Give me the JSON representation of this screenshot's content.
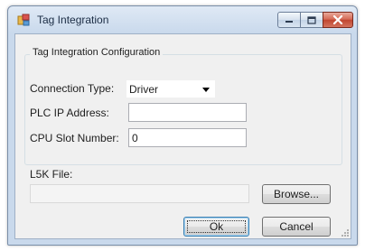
{
  "window": {
    "title": "Tag Integration",
    "app_icon": "tag-app-icon",
    "controls": [
      "minimize-icon",
      "maximize-icon",
      "close-icon"
    ]
  },
  "group": {
    "label": "Tag Integration Configuration"
  },
  "connection_type": {
    "label": "Connection Type:",
    "selected": "Driver"
  },
  "plc_ip": {
    "label": "PLC IP Address:",
    "value": ""
  },
  "cpu_slot": {
    "label": "CPU Slot Number:",
    "value": "0"
  },
  "l5k": {
    "label": "L5K File:",
    "value": "",
    "browse_label": "Browse..."
  },
  "buttons": {
    "ok_label": "Ok",
    "cancel_label": "Cancel"
  },
  "colors": {
    "titlebar": "#c9d9ec",
    "client": "#f0f0f0",
    "close_button": "#c04630",
    "default_button_border": "#3c7fb1"
  }
}
